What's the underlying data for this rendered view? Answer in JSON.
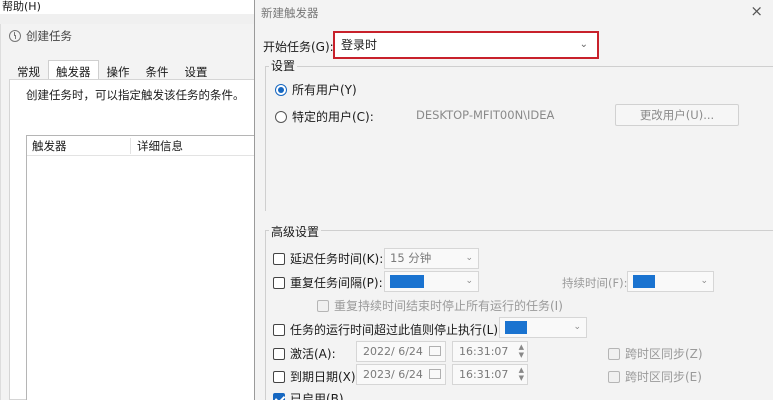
{
  "background_window": {
    "menu_help": "帮助(H)",
    "title": "创建任务",
    "tabs": [
      "常规",
      "触发器",
      "操作",
      "条件",
      "设置"
    ],
    "trigger_description": "创建任务时，可以指定触发该任务的条件。",
    "columns": [
      "触发器",
      "详细信息"
    ]
  },
  "dialog": {
    "title": "新建触发器",
    "close": "×",
    "begin_label": "开始任务(G):",
    "begin_value": "登录时",
    "settings": {
      "legend": "设置",
      "radio_any_user": "所有用户(Y)",
      "radio_specific_user": "特定的用户(C):",
      "user_name": "DESKTOP-MFIT00N\\IDEA",
      "change_user_button": "更改用户(U)..."
    },
    "advanced": {
      "legend": "高级设置",
      "delay_label": "延迟任务时间(K):",
      "delay_value": "15 分钟",
      "repeat_label": "重复任务间隔(P):",
      "duration_label": "持续时间(F):",
      "stop_all_label": "重复持续时间结束时停止所有运行的任务(I)",
      "stop_long_label": "任务的运行时间超过此值则停止执行(L):",
      "activate_label": "激活(A):",
      "activate_date": "2022/ 6/24",
      "activate_time": "16:31:07",
      "sync_tz_z": "跨时区同步(Z)",
      "expire_label": "到期日期(X):",
      "expire_date": "2023/ 6/24",
      "expire_time": "16:31:07",
      "sync_tz_e": "跨时区同步(E)",
      "enabled_label": "已启用(B)"
    }
  },
  "colors": {
    "highlight_border": "#c8212b",
    "accent_blue": "#1667c1"
  }
}
